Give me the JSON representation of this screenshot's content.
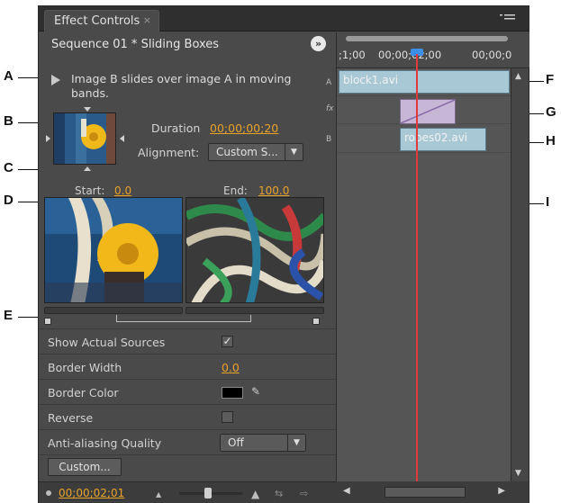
{
  "panel": {
    "tab_title": "Effect Controls",
    "tab_close": "×",
    "menu_icon": "menu-icon",
    "sequence_title": "Sequence 01 * Sliding Boxes",
    "sequence_toggle": "»"
  },
  "effect": {
    "description": "Image B slides over image A in moving bands.",
    "duration_label": "Duration",
    "duration_value": "00;00;00;20",
    "alignment_label": "Alignment:",
    "alignment_value": "Custom S...",
    "start_label": "Start:",
    "start_value": "0.0",
    "end_label": "End:",
    "end_value": "100.0"
  },
  "properties": [
    {
      "label": "Show Actual Sources",
      "type": "checkbox",
      "checked": true,
      "mark": "✓"
    },
    {
      "label": "Border Width",
      "type": "number",
      "value": "0.0"
    },
    {
      "label": "Border Color",
      "type": "color",
      "value": "#000000"
    },
    {
      "label": "Reverse",
      "type": "checkbox",
      "checked": false,
      "mark": ""
    },
    {
      "label": "Anti-aliasing Quality",
      "type": "select",
      "value": "Off"
    }
  ],
  "custom_button": "Custom...",
  "bottom": {
    "timecode": "00;00;02;01"
  },
  "timeline": {
    "ruler_labels": [
      ";1;00",
      "00;00;02;00",
      "00;00;0"
    ],
    "track_a": "A",
    "track_fx": "fx",
    "track_b": "B",
    "clip_a": "block1.avi",
    "clip_b": "ropes02.avi"
  },
  "callouts": [
    "A",
    "B",
    "C",
    "D",
    "E",
    "F",
    "G",
    "H",
    "I"
  ],
  "colors": {
    "accent": "#e8a22a",
    "playhead": "#e23a3a",
    "clip": "#a9c8d6",
    "transition": "#c7b6d6",
    "panel": "#4a4a4a"
  }
}
